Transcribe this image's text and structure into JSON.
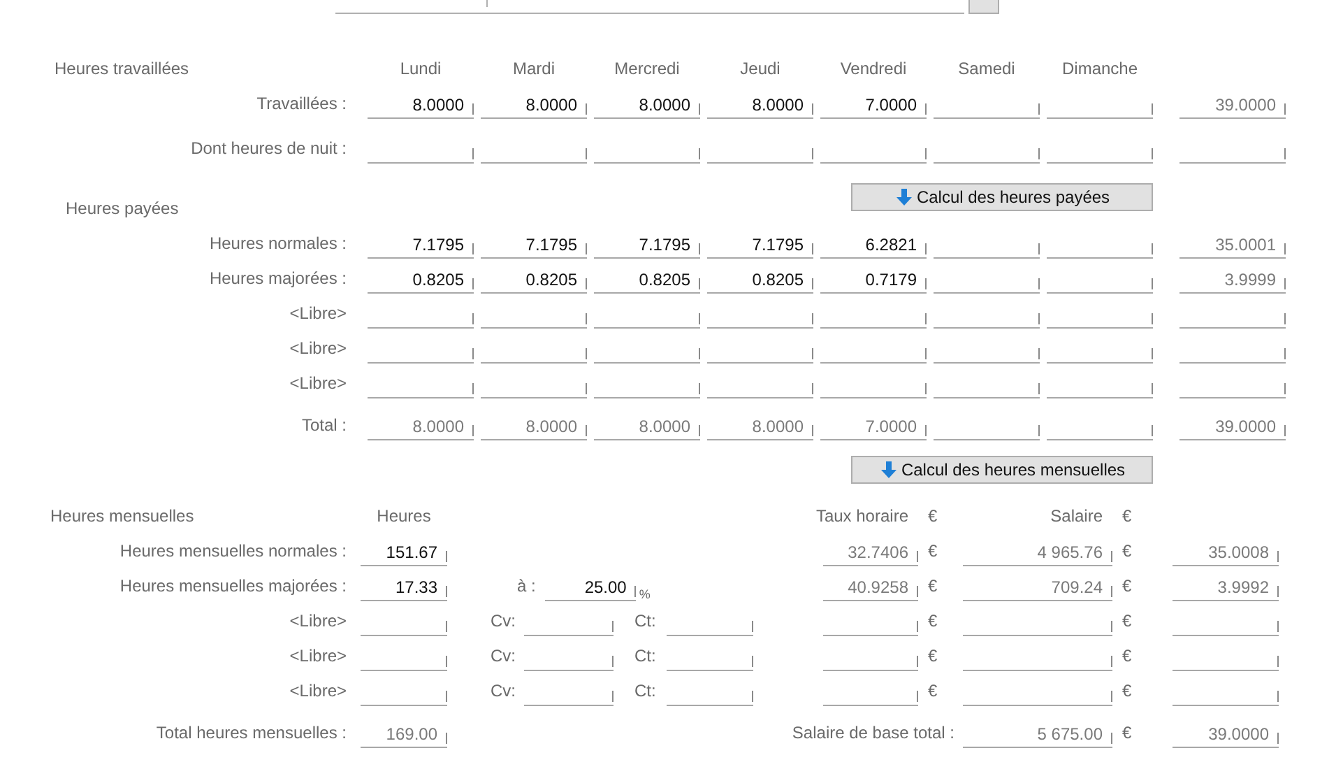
{
  "worked": {
    "title": "Heures travaillées",
    "days": [
      "Lundi",
      "Mardi",
      "Mercredi",
      "Jeudi",
      "Vendredi",
      "Samedi",
      "Dimanche"
    ],
    "rows": [
      {
        "label": "Travaillées :",
        "values": [
          "8.0000",
          "8.0000",
          "8.0000",
          "8.0000",
          "7.0000"
        ],
        "total": "39.0000"
      },
      {
        "label": "Dont heures de nuit :",
        "values": []
      }
    ]
  },
  "paid": {
    "title": "Heures payées",
    "button": "Calcul des heures payées",
    "rows": [
      {
        "kind": "entry",
        "label": "Heures normales :",
        "values": [
          "7.1795",
          "7.1795",
          "7.1795",
          "7.1795",
          "6.2821"
        ],
        "total": "35.0001"
      },
      {
        "kind": "entry",
        "label": "Heures majorées :",
        "values": [
          "0.8205",
          "0.8205",
          "0.8205",
          "0.8205",
          "0.7179"
        ],
        "total": "3.9999"
      },
      {
        "kind": "entry",
        "label": "<Libre>"
      },
      {
        "kind": "entry",
        "label": "<Libre>"
      },
      {
        "kind": "entry",
        "label": "<Libre>"
      },
      {
        "kind": "total",
        "label": "Total :",
        "values": [
          "8.0000",
          "8.0000",
          "8.0000",
          "8.0000",
          "7.0000"
        ],
        "total": "39.0000"
      }
    ]
  },
  "monthly": {
    "button": "Calcul des heures mensuelles",
    "title": "Heures mensuelles",
    "hours_header": "Heures",
    "rate_header": "Taux horaire",
    "rate_header_currency": "€",
    "salary_header": "Salaire",
    "salary_header_currency": "€",
    "rows": [
      {
        "kind": "normal",
        "label": "Heures mensuelles normales :",
        "hours": "151.67",
        "rate": "32.7406",
        "rate_currency": "€",
        "salary": "4 965.76",
        "salary_currency": "€",
        "total": "35.0008"
      },
      {
        "kind": "majoree",
        "label": "Heures mensuelles majorées :",
        "hours": "17.33",
        "at_label": "à :",
        "percent": "25.00",
        "percent_sign": "%",
        "rate": "40.9258",
        "rate_currency": "€",
        "salary": "709.24",
        "salary_currency": "€",
        "total": "3.9992"
      },
      {
        "kind": "libre",
        "label": "<Libre>",
        "cv_label": "Cv:",
        "ct_label": "Ct:",
        "rate_currency": "€",
        "salary_currency": "€"
      },
      {
        "kind": "libre",
        "label": "<Libre>",
        "cv_label": "Cv:",
        "ct_label": "Ct:",
        "rate_currency": "€",
        "salary_currency": "€"
      },
      {
        "kind": "libre",
        "label": "<Libre>",
        "cv_label": "Cv:",
        "ct_label": "Ct:",
        "rate_currency": "€",
        "salary_currency": "€"
      }
    ],
    "total": {
      "label": "Total heures mensuelles :",
      "hours": "169.00",
      "salary_label": "Salaire de base total :",
      "salary": "5 675.00",
      "salary_currency": "€",
      "total": "39.0000"
    }
  }
}
